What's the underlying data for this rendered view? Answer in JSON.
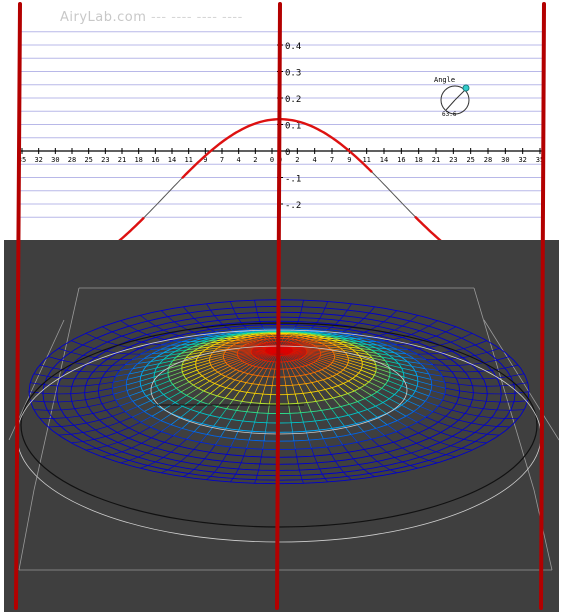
{
  "watermark": {
    "brand": "AiryLab.com",
    "dashes": "--- ---- ---- ----"
  },
  "profile": {
    "colors": {
      "background": "#ffffff",
      "gridline": "#b8b8e8",
      "axis": "#000000",
      "curve": "#555555",
      "highlight": "#dd1111"
    },
    "y_ticks": [
      {
        "value": 0.4,
        "label": "0.4"
      },
      {
        "value": 0.3,
        "label": "0.3"
      },
      {
        "value": 0.2,
        "label": "0.2"
      },
      {
        "value": 0.1,
        "label": "0.1"
      },
      {
        "value": 0,
        "label": "0"
      },
      {
        "value": -0.1,
        "label": "-.1"
      },
      {
        "value": -0.2,
        "label": "-.2"
      }
    ],
    "x_tick_labels_left": [
      "35",
      "32",
      "30",
      "28",
      "25",
      "23",
      "21",
      "18",
      "16",
      "14",
      "11",
      "9",
      "7",
      "4",
      "2",
      "0"
    ],
    "x_tick_labels_right": [
      "0",
      "2",
      "4",
      "7",
      "9",
      "11",
      "14",
      "16",
      "18",
      "21",
      "23",
      "25",
      "28",
      "30",
      "32",
      "35"
    ]
  },
  "angle_widget": {
    "label": "Angle",
    "value": "63.6",
    "knob_color": "#33cccc"
  },
  "mesh": {
    "background": "#3f3f3f",
    "palette": [
      "#0000cc",
      "#00a0ff",
      "#00ddaa",
      "#ffee00",
      "#ff8800",
      "#dd0000"
    ]
  },
  "markers": {
    "color": "#b30000"
  }
}
